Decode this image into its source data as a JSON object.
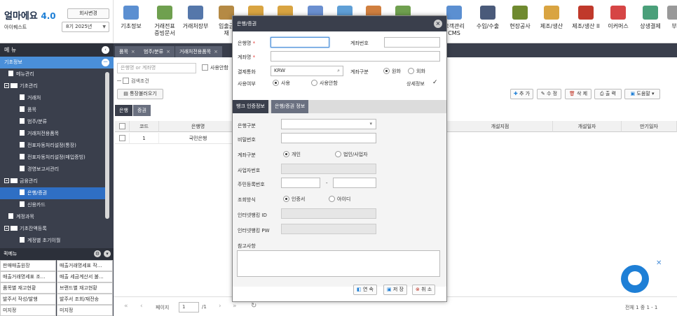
{
  "app": {
    "logo": "얼마에요",
    "version": "4.0",
    "company_name": "아이퀘스트",
    "company_change_btn": "회사변경",
    "period": "8기 2025년"
  },
  "top_menu": [
    {
      "label": "기초정보",
      "color": "#5b8fd1"
    },
    {
      "label": "거래전표\n증빙문서",
      "color": "#6fa04f"
    },
    {
      "label": "거래처장부",
      "color": "#5577aa"
    },
    {
      "label": "입출금\n재",
      "color": "#b58a44"
    },
    {
      "label": "",
      "color": "#d9a441"
    },
    {
      "label": "",
      "color": "#d9a441"
    },
    {
      "label": "",
      "color": "#6a8fd0"
    },
    {
      "label": "",
      "color": "#5f9fd6"
    },
    {
      "label": "",
      "color": "#d07f3f"
    },
    {
      "label": "",
      "color": "#6fa04f"
    },
    {
      "label": "고객관리\nCMS",
      "color": "#5b8fd1"
    },
    {
      "label": "수입/수출",
      "color": "#4a5a7a"
    },
    {
      "label": "현장공사",
      "color": "#6f8a2f"
    },
    {
      "label": "제조/생산",
      "color": "#d9a441"
    },
    {
      "label": "제조/생산 II",
      "color": "#c0392b"
    },
    {
      "label": "이커머스",
      "color": "#d64545"
    },
    {
      "label": "상생결제",
      "color": "#4aa07a"
    },
    {
      "label": "부",
      "color": "#999999"
    }
  ],
  "sidebar": {
    "title": "메 뉴",
    "items": [
      {
        "label": "기초정보",
        "type": "section"
      },
      {
        "label": "메뉴관리",
        "type": "doc",
        "indent": 1
      },
      {
        "label": "기초관리",
        "type": "folder",
        "indent": 0
      },
      {
        "label": "거래처",
        "type": "doc",
        "indent": 2
      },
      {
        "label": "품목",
        "type": "doc",
        "indent": 2
      },
      {
        "label": "범주/분류",
        "type": "doc",
        "indent": 2
      },
      {
        "label": "거래처전용품목",
        "type": "doc",
        "indent": 2
      },
      {
        "label": "전표자동처리설정(통장)",
        "type": "doc",
        "indent": 2
      },
      {
        "label": "전표자동처리설정(매입증빙)",
        "type": "doc",
        "indent": 2
      },
      {
        "label": "경영보고서관리",
        "type": "doc",
        "indent": 2
      },
      {
        "label": "금융관리",
        "type": "folder",
        "indent": 0
      },
      {
        "label": "은행/증권",
        "type": "doc",
        "indent": 2,
        "active": true
      },
      {
        "label": "신용카드",
        "type": "doc",
        "indent": 2
      },
      {
        "label": "계정과목",
        "type": "doc",
        "indent": 1
      },
      {
        "label": "기초잔액등록",
        "type": "folder",
        "indent": 0
      },
      {
        "label": "계정별 초기이월",
        "type": "doc",
        "indent": 2
      }
    ],
    "quick_title": "퀵메뉴",
    "quick_items": [
      "판매매출원장",
      "매출거래명세표 작...",
      "매출거래명세표 조...",
      "매출 세금계산서 불...",
      "품목별 재고현황",
      "브랜드별 재고현황",
      "발주서 작성/발행",
      "발주서 조회/재전송",
      "미지정",
      "미지정"
    ]
  },
  "tabs": [
    {
      "label": "품목"
    },
    {
      "label": "범주/분류"
    },
    {
      "label": "거래처전용품목"
    }
  ],
  "main": {
    "search_placeholder": "은행명 or 계좌명",
    "use_only_label": "사용안함",
    "search_cond_label": "검색조건",
    "fetch_btn": "통장불러오기",
    "toolbar": {
      "add": "추 가",
      "edit": "수 정",
      "delete": "삭 제",
      "print": "출 력",
      "help": "도움말"
    },
    "subtabs": [
      "은행",
      "증권"
    ],
    "columns": [
      "코드",
      "은행명",
      "개설지점",
      "개설일자",
      "만기일자"
    ],
    "rows": [
      {
        "code": "1",
        "bank": "국민은행"
      }
    ],
    "pager": {
      "page_label": "페이지",
      "page": "1",
      "total_pages": "/1",
      "summary": "전체 1 중 1 - 1"
    }
  },
  "dialog": {
    "title": "은행/증권",
    "fields": {
      "bank_name": "은행명",
      "account_number": "계좌번호",
      "account_name": "계좌명",
      "currency": "결제통화",
      "currency_value": "KRW",
      "account_type": "계좌구분",
      "type_krw": "원화",
      "type_fx": "외화",
      "use_yn": "사용여부",
      "use": "사용",
      "not_use": "사용안함",
      "detail": "상세정보"
    },
    "tabs": [
      "뱅크 인증정보",
      "은행/증권 정보"
    ],
    "auth": {
      "bank_type": "은행구분",
      "password": "비밀번호",
      "account_kind": "계좌구분",
      "personal": "개인",
      "corporate": "법인/사업자",
      "biz_number": "사업자번호",
      "resident_number": "주민등록번호",
      "dash": "-",
      "lookup_method": "조회방식",
      "cert": "인증서",
      "id": "아이디",
      "ib_id": "인터넷뱅킹 ID",
      "ib_pw": "인터넷뱅킹 PW",
      "note": "참고사항"
    },
    "buttons": {
      "link": "연 속",
      "save": "저 장",
      "cancel": "취 소"
    }
  }
}
